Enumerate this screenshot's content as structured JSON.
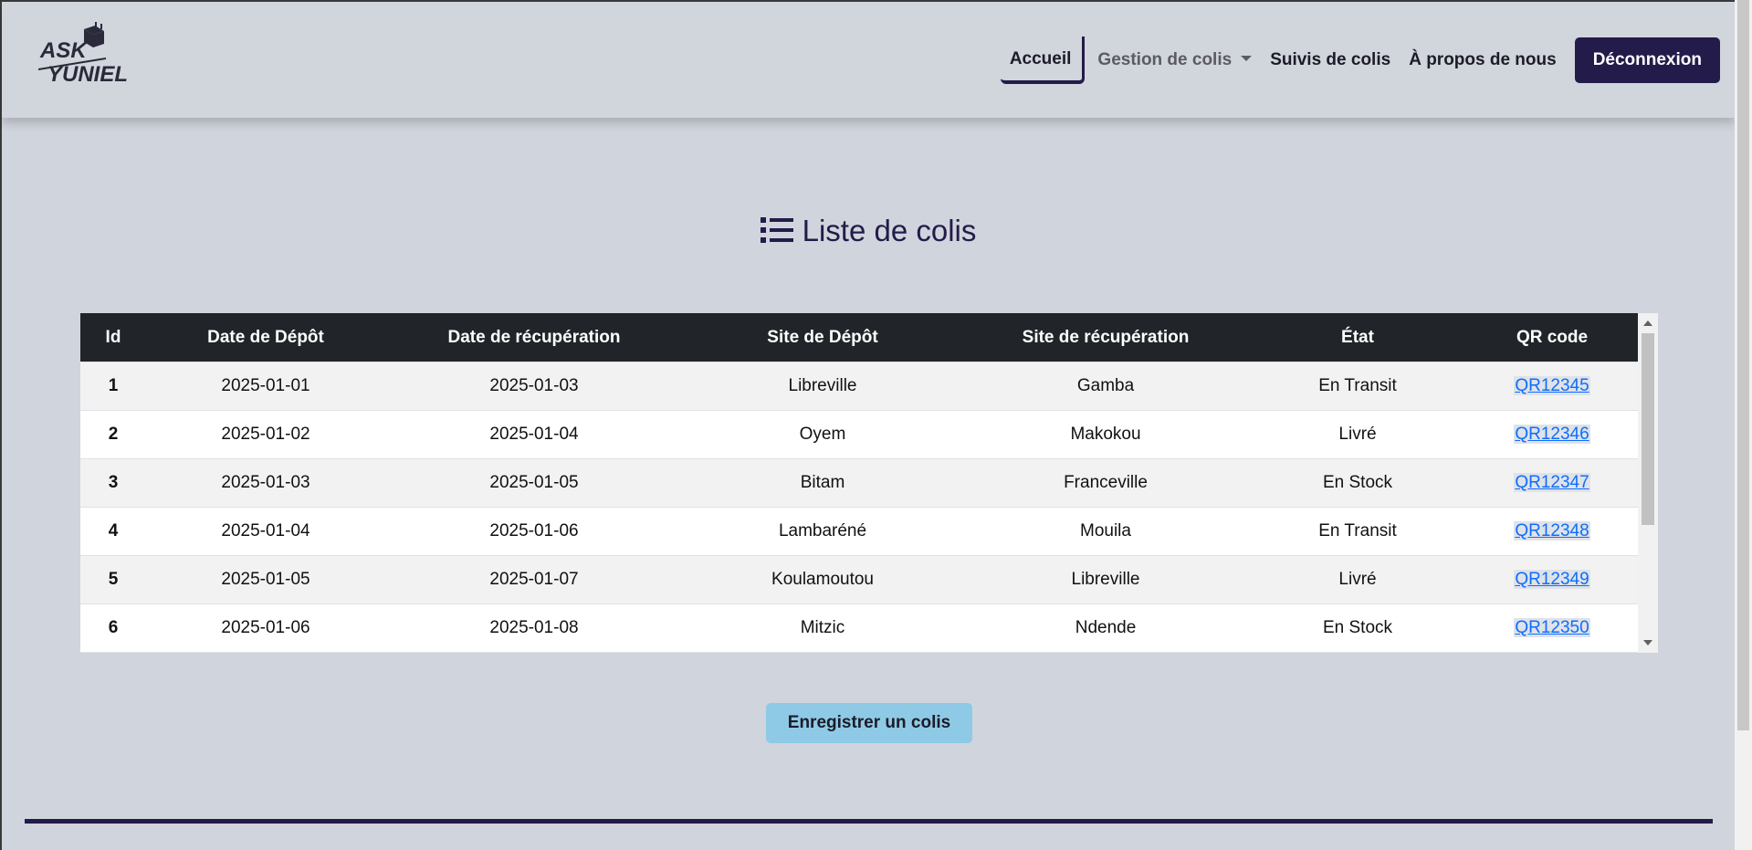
{
  "brand": {
    "line1": "ASK",
    "line2": "YUNIEL"
  },
  "nav": {
    "home": "Accueil",
    "manage": "Gestion de colis",
    "tracking": "Suivis de colis",
    "about": "À propos de nous",
    "logout": "Déconnexion"
  },
  "page": {
    "title": "Liste de colis"
  },
  "table": {
    "headers": [
      "Id",
      "Date de Dépôt",
      "Date de récupération",
      "Site de Dépôt",
      "Site de récupération",
      "État",
      "QR code"
    ],
    "rows": [
      [
        "1",
        "2025-01-01",
        "2025-01-03",
        "Libreville",
        "Gamba",
        "En Transit",
        "QR12345"
      ],
      [
        "2",
        "2025-01-02",
        "2025-01-04",
        "Oyem",
        "Makokou",
        "Livré",
        "QR12346"
      ],
      [
        "3",
        "2025-01-03",
        "2025-01-05",
        "Bitam",
        "Franceville",
        "En Stock",
        "QR12347"
      ],
      [
        "4",
        "2025-01-04",
        "2025-01-06",
        "Lambaréné",
        "Mouila",
        "En Transit",
        "QR12348"
      ],
      [
        "5",
        "2025-01-05",
        "2025-01-07",
        "Koulamoutou",
        "Libreville",
        "Livré",
        "QR12349"
      ],
      [
        "6",
        "2025-01-06",
        "2025-01-08",
        "Mitzic",
        "Ndende",
        "En Stock",
        "QR12350"
      ]
    ]
  },
  "actions": {
    "register": "Enregistrer un colis"
  },
  "colors": {
    "primary": "#231b4a",
    "accent": "#8ecae6",
    "link": "#0d6efd",
    "background": "#d0d4dc"
  }
}
